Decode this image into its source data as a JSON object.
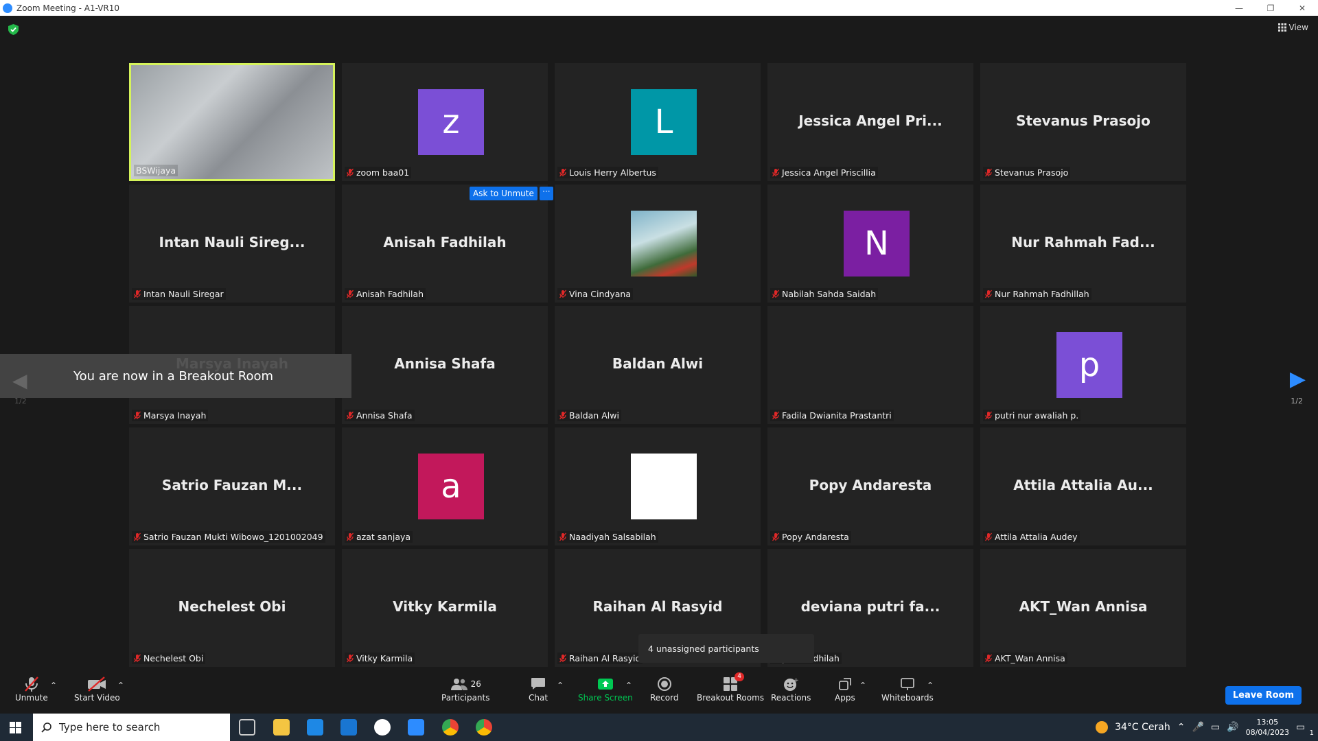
{
  "window": {
    "title": "Zoom Meeting - A1-VR10",
    "minimize": "—",
    "restore": "❐",
    "close": "✕"
  },
  "view_label": "View",
  "tiles": [
    {
      "id": "t0",
      "label": "BSWijaya",
      "kind": "video",
      "active": true
    },
    {
      "id": "t1",
      "label": "zoom baa01",
      "kind": "avatar",
      "letter": "z",
      "color": "#7b4fd6"
    },
    {
      "id": "t2",
      "label": "Louis Herry Albertus",
      "kind": "avatar",
      "letter": "L",
      "color": "#0097a7"
    },
    {
      "id": "t3",
      "label": "Jessica Angel Priscillia",
      "kind": "name",
      "big": "Jessica Angel Pri..."
    },
    {
      "id": "t4",
      "label": "Stevanus Prasojo",
      "kind": "name",
      "big": "Stevanus Prasojo"
    },
    {
      "id": "t5",
      "label": "Intan Nauli Siregar",
      "kind": "name",
      "big": "Intan Nauli Sireg..."
    },
    {
      "id": "t6",
      "label": "Anisah Fadhilah",
      "kind": "name",
      "big": "Anisah Fadhilah"
    },
    {
      "id": "t7",
      "label": "Vina Cindyana",
      "kind": "photo"
    },
    {
      "id": "t8",
      "label": "Nabilah Sahda Saidah",
      "kind": "avatar",
      "letter": "N",
      "color": "#7b1fa2"
    },
    {
      "id": "t9",
      "label": "Nur Rahmah Fadhillah",
      "kind": "name",
      "big": "Nur Rahmah Fad..."
    },
    {
      "id": "t10",
      "label": "Marsya Inayah",
      "kind": "name",
      "big": "Marsya Inayah"
    },
    {
      "id": "t11",
      "label": "Annisa Shafa",
      "kind": "name",
      "big": "Annisa Shafa"
    },
    {
      "id": "t12",
      "label": "Baldan Alwi",
      "kind": "name",
      "big": "Baldan Alwi"
    },
    {
      "id": "t13",
      "label": "Fadila Dwianita Prastantri",
      "kind": "empty"
    },
    {
      "id": "t14",
      "label": "putri nur awaliah p.",
      "kind": "avatar",
      "letter": "p",
      "color": "#7b4fd6"
    },
    {
      "id": "t15",
      "label": "Satrio Fauzan Mukti Wibowo_1201002049",
      "kind": "name",
      "big": "Satrio Fauzan M..."
    },
    {
      "id": "t16",
      "label": "azat sanjaya",
      "kind": "avatar",
      "letter": "a",
      "color": "#c2185b"
    },
    {
      "id": "t17",
      "label": "Naadiyah Salsabilah",
      "kind": "avatar",
      "letter": "",
      "color": "#ffffff"
    },
    {
      "id": "t18",
      "label": "Popy Andaresta",
      "kind": "name",
      "big": "Popy Andaresta"
    },
    {
      "id": "t19",
      "label": "Attila Attalia Audey",
      "kind": "name",
      "big": "Attila Attalia Au..."
    },
    {
      "id": "t20",
      "label": "Nechelest Obi",
      "kind": "name",
      "big": "Nechelest Obi"
    },
    {
      "id": "t21",
      "label": "Vitky Karmila",
      "kind": "name",
      "big": "Vitky Karmila"
    },
    {
      "id": "t22",
      "label": "Raihan Al Rasyid",
      "kind": "name",
      "big": "Raihan Al Rasyid"
    },
    {
      "id": "t23",
      "label": "putri fadhilah",
      "kind": "name",
      "big": "deviana putri fa..."
    },
    {
      "id": "t24",
      "label": "AKT_Wan Annisa",
      "kind": "name",
      "big": "AKT_Wan Annisa"
    }
  ],
  "ask_to_unmute": {
    "label": "Ask to Unmute",
    "more": "···"
  },
  "breakout_banner": "You are now in a Breakout Room",
  "page_indicator_left": "1/2",
  "page_indicator_right": "1/2",
  "unassigned_popup": "4 unassigned participants",
  "toolbar": {
    "unmute": "Unmute",
    "start_video": "Start Video",
    "participants": "Participants",
    "participants_count": "26",
    "chat": "Chat",
    "share_screen": "Share Screen",
    "record": "Record",
    "breakout_rooms": "Breakout Rooms",
    "breakout_badge": "4",
    "reactions": "Reactions",
    "apps": "Apps",
    "whiteboards": "Whiteboards",
    "leave_room": "Leave Room"
  },
  "taskbar": {
    "search_placeholder": "Type here to search",
    "weather": "34°C  Cerah",
    "time": "13:05",
    "date": "08/04/2023",
    "notification_count": "1"
  }
}
